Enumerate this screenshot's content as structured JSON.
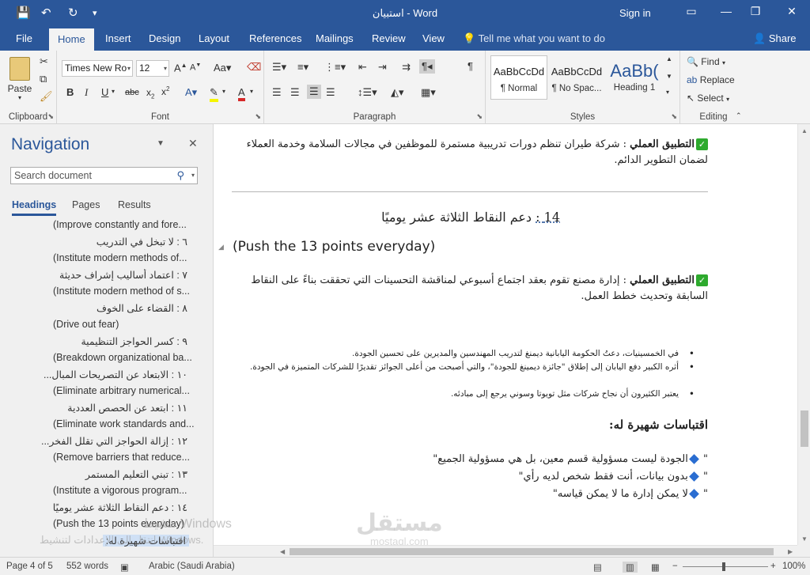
{
  "titlebar": {
    "title": "استبيان  -  Word",
    "signin": "Sign in",
    "qa_save": "💾",
    "qa_undo": "↶",
    "qa_redo": "↻",
    "qa_more": "▾",
    "win_restore": "▭",
    "win_minimize": "—",
    "win_maximize": "❐",
    "win_close": "✕"
  },
  "tabs": [
    "File",
    "Home",
    "Insert",
    "Design",
    "Layout",
    "References",
    "Mailings",
    "Review",
    "View"
  ],
  "tellme": "Tell me what you want to do",
  "share": "Share",
  "ribbon": {
    "clipboard": {
      "label": "Clipboard",
      "paste": "Paste"
    },
    "font": {
      "label": "Font",
      "name": "Times New Ro",
      "size": "12"
    },
    "paragraph": {
      "label": "Paragraph"
    },
    "styles": {
      "label": "Styles",
      "items": [
        {
          "sample": "AaBbCcDd",
          "name": "¶ Normal"
        },
        {
          "sample": "AaBbCcDd",
          "name": "¶ No Spac..."
        },
        {
          "sample": "AaBb(",
          "name": "Heading 1"
        }
      ]
    },
    "editing": {
      "label": "Editing",
      "find": "Find",
      "replace": "Replace",
      "select": "Select"
    }
  },
  "nav": {
    "title": "Navigation",
    "search_placeholder": "Search document",
    "tabs": [
      "Headings",
      "Pages",
      "Results"
    ],
    "headings": [
      {
        "text": "(Improve constantly and fore...",
        "lang": "en"
      },
      {
        "text": "٦ : لا تبخل في التدريب",
        "lang": "ar"
      },
      {
        "text": "(Institute modern methods of...",
        "lang": "en"
      },
      {
        "text": "٧ : اعتماد أساليب إشراف حديثة",
        "lang": "ar"
      },
      {
        "text": "(Institute modern method of s...",
        "lang": "en"
      },
      {
        "text": "٨ : القضاء على الخوف",
        "lang": "ar"
      },
      {
        "text": "(Drive out fear)",
        "lang": "en"
      },
      {
        "text": "٩ : كسر الحواجز التنظيمية",
        "lang": "ar"
      },
      {
        "text": "(Breakdown organizational ba...",
        "lang": "en"
      },
      {
        "text": "١٠ : الابتعاد عن التصريحات المبال...",
        "lang": "ar"
      },
      {
        "text": "(Eliminate arbitrary numerical...",
        "lang": "en"
      },
      {
        "text": "١١ : ابتعد عن الحصص العددية",
        "lang": "ar"
      },
      {
        "text": "(Eliminate work standards and...",
        "lang": "en"
      },
      {
        "text": "١٢ : إزالة الحواجز التي تقلل الفخر...",
        "lang": "ar"
      },
      {
        "text": "(Remove barriers that reduce...",
        "lang": "en"
      },
      {
        "text": "١٣ : تبني التعليم المستمر",
        "lang": "ar"
      },
      {
        "text": "(Institute a vigorous program...",
        "lang": "en"
      },
      {
        "text": "١٤ : دعم النقاط الثلاثة عشر يوميًا",
        "lang": "ar"
      },
      {
        "text": "(Push the 13 points everyday)",
        "lang": "en"
      },
      {
        "text": "اقتباسات شهيرة له:",
        "lang": "ar",
        "current": true
      }
    ]
  },
  "doc": {
    "p1_bold": "التطبيق العملي",
    "p1_text": " : شركة طيران تنظم دورات تدريبية مستمرة للموظفين في مجالات السلامة وخدمة العملاء لضمان التطوير الدائم.",
    "heading14_num": "14 :",
    "heading14_ar": "دعم النقاط الثلاثة عشر يوميًا",
    "heading14_en": "(Push the 13 points everyday)",
    "p2_bold": "التطبيق العملي",
    "p2_text": " : إدارة مصنع تقوم بعقد اجتماع أسبوعي لمناقشة التحسينات التي تحققت بناءً على النقاط السابقة وتحديث خطط العمل.",
    "bullets": [
      "في الخمسينيات، دعتُ الحكومة اليابانية ديمنغ لتدريب المهندسين والمديرين على تحسين الجودة.",
      "أثره الكبير دفع اليابان إلى إطلاق \"جائزة ديمينغ للجودة\"، والتي أصبحت من أعلى الجوائز تقديرًا للشركات المتميزة في الجودة.",
      "يعتبر الكثيرون أن نجاح شركات مثل تويوتا وسوني يرجع إلى مبادئه."
    ],
    "quotes_heading": "اقتباسات شهيرة له:",
    "quotes": [
      "الجودة ليست مسؤولية قسم معين، بل هي مسؤولية الجميع",
      "بدون بيانات، أنت فقط شخص لديه رأي",
      "لا يمكن إدارة ما لا يمكن قياسه"
    ]
  },
  "status": {
    "page": "Page 4 of 5",
    "words": "552 words",
    "language": "Arabic (Saudi Arabia)",
    "zoom": "100%"
  },
  "watermarks": {
    "activate_ar": "تنشيط Windows",
    "activate_ar2": "انتقل إلى الإعدادات لتنشيط Windows.",
    "logo_ar": "مستقل",
    "logo_en": "mostaql.com"
  }
}
